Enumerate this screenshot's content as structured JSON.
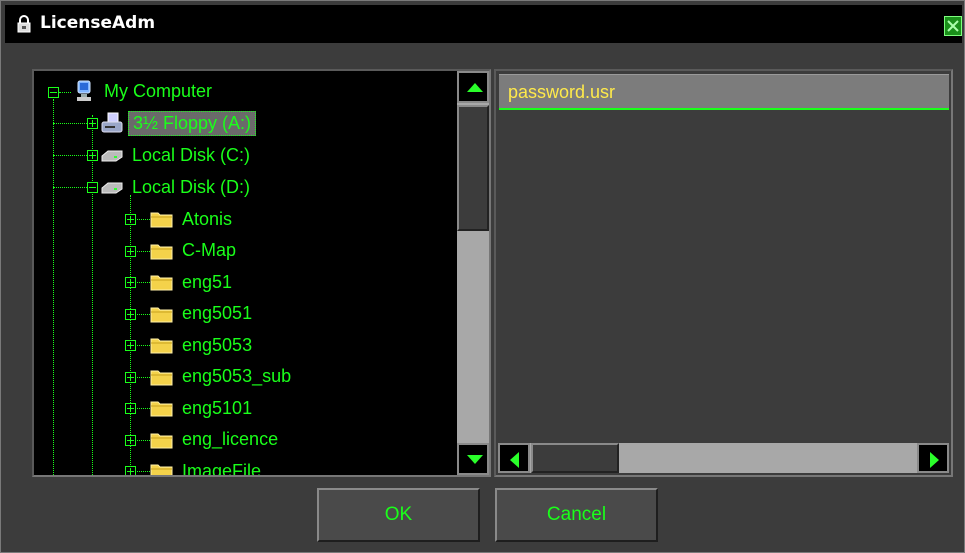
{
  "window": {
    "title": "LicenseAdm",
    "accent": "#1aff1a"
  },
  "tree": {
    "root": {
      "label": "My Computer",
      "icon": "computer-icon"
    },
    "drives": [
      {
        "label": "3½ Floppy (A:)",
        "icon": "floppy-drive-icon",
        "selected": true
      },
      {
        "label": "Local Disk (C:)",
        "icon": "hard-disk-icon"
      },
      {
        "label": "Local Disk (D:)",
        "icon": "hard-disk-icon"
      }
    ],
    "folders": [
      "Atonis",
      "C-Map",
      "eng51",
      "eng5051",
      "eng5053",
      "eng5053_sub",
      "eng5101",
      "eng_licence",
      "ImageFile"
    ]
  },
  "files": {
    "items": [
      "password.usr"
    ],
    "highlight": "#ffea4a"
  },
  "buttons": {
    "ok": "OK",
    "cancel": "Cancel"
  }
}
